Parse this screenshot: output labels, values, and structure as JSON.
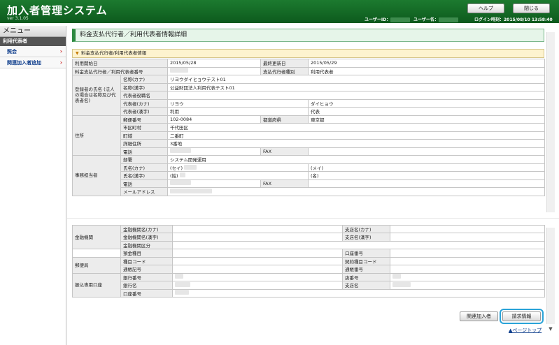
{
  "header": {
    "title": "加入者管理システム",
    "version": "ver 3.1.05",
    "help_label": "ヘルプ",
    "close_label": "閉じる",
    "user_id_label": "ユーザーID：",
    "user_name_label": "ユーザー名：",
    "login_time": "ログイン時刻：2015/08/10 13:58:40"
  },
  "sidebar": {
    "title": "メニュー",
    "section": "利用代表者",
    "items": [
      {
        "label": "照会",
        "arrow": "›"
      },
      {
        "label": "関連加入者追加",
        "arrow": "›"
      }
    ]
  },
  "main": {
    "page_title": "料金支払代行者／利用代表者情報詳細",
    "section_title": "料金支払代行者/利用代表者情報",
    "section_marker": "▼",
    "top_rows": {
      "start_date_label": "利用開始日",
      "start_date": "2015/05/28",
      "last_update_label": "最終更新日",
      "last_update": "2015/05/29",
      "number_label": "料金支払代行者／利用代表者番号",
      "type_label": "支払代行者種別",
      "type_value": "利用代表者"
    },
    "registrant": {
      "group": "登録者の氏名 (法人の場合は名称及び代表者名)",
      "kana_label": "名称(カナ)",
      "kana_value": "リヨウダイヒョウテスト01",
      "kanji_label": "名称(漢字)",
      "kanji_value": "公益財団法人利用代表テスト01",
      "title_label": "代表者役職名",
      "rep_kana_label": "代表者(カナ)",
      "rep_kana_sei": "リヨウ",
      "rep_kana_mei": "ダイヒョウ",
      "rep_kanji_label": "代表者(漢字)",
      "rep_kanji_sei": "利用",
      "rep_kanji_mei": "代表"
    },
    "address": {
      "group": "住所",
      "postal_label": "郵便番号",
      "postal_value": "102-0084",
      "pref_label": "都道府県",
      "pref_value": "東京都",
      "city_label": "市区町村",
      "city_value": "千代田区",
      "town_label": "町域",
      "town_value": "二番町",
      "detail_label": "詳細住所",
      "detail_value": "3番地",
      "phone_label": "電話",
      "fax_label": "FAX"
    },
    "contact": {
      "group": "事務担当者",
      "dept_label": "部署",
      "dept_value": "システム開発運用",
      "name_kana_label": "氏名(カナ)",
      "name_kana_sei": "(セイ)",
      "name_kana_mei": "(メイ)",
      "name_kanji_label": "氏名(漢字)",
      "name_kanji_sei": "(姓)",
      "name_kanji_mei": "(名)",
      "phone_label": "電話",
      "fax_label": "FAX",
      "mail_label": "メールアドレス"
    },
    "bank": {
      "group": "金融機関",
      "bank_kana_label": "金融機関名(カナ)",
      "branch_kana_label": "支店名(カナ)",
      "bank_kanji_label": "金融機関名(漢字)",
      "branch_kanji_label": "支店名(漢字)",
      "bank_type_label": "金融機関区分"
    },
    "account": {
      "deposit_label": "預金種目",
      "account_no_label": "口座番号"
    },
    "post": {
      "group": "郵便局",
      "type_code_label": "種目コード",
      "contract_code_label": "契約種目コード",
      "passbook_label": "通帳記号",
      "passbook_no_label": "通帳番号"
    },
    "transfer": {
      "group": "振込専用口座",
      "bank_no_label": "銀行番号",
      "branch_no_label": "店番号",
      "bank_name_label": "銀行名",
      "branch_name_label": "支店名",
      "account_no_label": "口座番号"
    },
    "buttons": {
      "related_label": "関連加入者",
      "billing_label": "請求情報"
    },
    "page_top": "▲ページトップ"
  }
}
